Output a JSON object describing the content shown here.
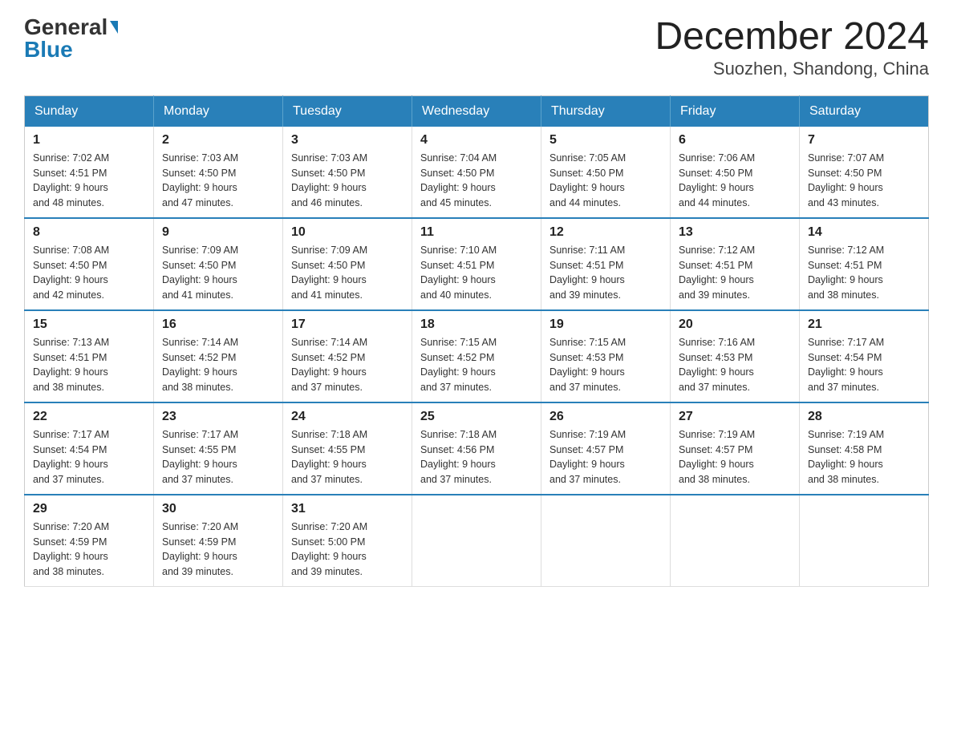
{
  "header": {
    "logo_general": "General",
    "logo_blue": "Blue",
    "month_title": "December 2024",
    "location": "Suozhen, Shandong, China"
  },
  "days_of_week": [
    "Sunday",
    "Monday",
    "Tuesday",
    "Wednesday",
    "Thursday",
    "Friday",
    "Saturday"
  ],
  "weeks": [
    [
      {
        "day": "1",
        "sunrise": "7:02 AM",
        "sunset": "4:51 PM",
        "daylight": "9 hours and 48 minutes."
      },
      {
        "day": "2",
        "sunrise": "7:03 AM",
        "sunset": "4:50 PM",
        "daylight": "9 hours and 47 minutes."
      },
      {
        "day": "3",
        "sunrise": "7:03 AM",
        "sunset": "4:50 PM",
        "daylight": "9 hours and 46 minutes."
      },
      {
        "day": "4",
        "sunrise": "7:04 AM",
        "sunset": "4:50 PM",
        "daylight": "9 hours and 45 minutes."
      },
      {
        "day": "5",
        "sunrise": "7:05 AM",
        "sunset": "4:50 PM",
        "daylight": "9 hours and 44 minutes."
      },
      {
        "day": "6",
        "sunrise": "7:06 AM",
        "sunset": "4:50 PM",
        "daylight": "9 hours and 44 minutes."
      },
      {
        "day": "7",
        "sunrise": "7:07 AM",
        "sunset": "4:50 PM",
        "daylight": "9 hours and 43 minutes."
      }
    ],
    [
      {
        "day": "8",
        "sunrise": "7:08 AM",
        "sunset": "4:50 PM",
        "daylight": "9 hours and 42 minutes."
      },
      {
        "day": "9",
        "sunrise": "7:09 AM",
        "sunset": "4:50 PM",
        "daylight": "9 hours and 41 minutes."
      },
      {
        "day": "10",
        "sunrise": "7:09 AM",
        "sunset": "4:50 PM",
        "daylight": "9 hours and 41 minutes."
      },
      {
        "day": "11",
        "sunrise": "7:10 AM",
        "sunset": "4:51 PM",
        "daylight": "9 hours and 40 minutes."
      },
      {
        "day": "12",
        "sunrise": "7:11 AM",
        "sunset": "4:51 PM",
        "daylight": "9 hours and 39 minutes."
      },
      {
        "day": "13",
        "sunrise": "7:12 AM",
        "sunset": "4:51 PM",
        "daylight": "9 hours and 39 minutes."
      },
      {
        "day": "14",
        "sunrise": "7:12 AM",
        "sunset": "4:51 PM",
        "daylight": "9 hours and 38 minutes."
      }
    ],
    [
      {
        "day": "15",
        "sunrise": "7:13 AM",
        "sunset": "4:51 PM",
        "daylight": "9 hours and 38 minutes."
      },
      {
        "day": "16",
        "sunrise": "7:14 AM",
        "sunset": "4:52 PM",
        "daylight": "9 hours and 38 minutes."
      },
      {
        "day": "17",
        "sunrise": "7:14 AM",
        "sunset": "4:52 PM",
        "daylight": "9 hours and 37 minutes."
      },
      {
        "day": "18",
        "sunrise": "7:15 AM",
        "sunset": "4:52 PM",
        "daylight": "9 hours and 37 minutes."
      },
      {
        "day": "19",
        "sunrise": "7:15 AM",
        "sunset": "4:53 PM",
        "daylight": "9 hours and 37 minutes."
      },
      {
        "day": "20",
        "sunrise": "7:16 AM",
        "sunset": "4:53 PM",
        "daylight": "9 hours and 37 minutes."
      },
      {
        "day": "21",
        "sunrise": "7:17 AM",
        "sunset": "4:54 PM",
        "daylight": "9 hours and 37 minutes."
      }
    ],
    [
      {
        "day": "22",
        "sunrise": "7:17 AM",
        "sunset": "4:54 PM",
        "daylight": "9 hours and 37 minutes."
      },
      {
        "day": "23",
        "sunrise": "7:17 AM",
        "sunset": "4:55 PM",
        "daylight": "9 hours and 37 minutes."
      },
      {
        "day": "24",
        "sunrise": "7:18 AM",
        "sunset": "4:55 PM",
        "daylight": "9 hours and 37 minutes."
      },
      {
        "day": "25",
        "sunrise": "7:18 AM",
        "sunset": "4:56 PM",
        "daylight": "9 hours and 37 minutes."
      },
      {
        "day": "26",
        "sunrise": "7:19 AM",
        "sunset": "4:57 PM",
        "daylight": "9 hours and 37 minutes."
      },
      {
        "day": "27",
        "sunrise": "7:19 AM",
        "sunset": "4:57 PM",
        "daylight": "9 hours and 38 minutes."
      },
      {
        "day": "28",
        "sunrise": "7:19 AM",
        "sunset": "4:58 PM",
        "daylight": "9 hours and 38 minutes."
      }
    ],
    [
      {
        "day": "29",
        "sunrise": "7:20 AM",
        "sunset": "4:59 PM",
        "daylight": "9 hours and 38 minutes."
      },
      {
        "day": "30",
        "sunrise": "7:20 AM",
        "sunset": "4:59 PM",
        "daylight": "9 hours and 39 minutes."
      },
      {
        "day": "31",
        "sunrise": "7:20 AM",
        "sunset": "5:00 PM",
        "daylight": "9 hours and 39 minutes."
      },
      null,
      null,
      null,
      null
    ]
  ],
  "labels": {
    "sunrise": "Sunrise:",
    "sunset": "Sunset:",
    "daylight": "Daylight:"
  }
}
